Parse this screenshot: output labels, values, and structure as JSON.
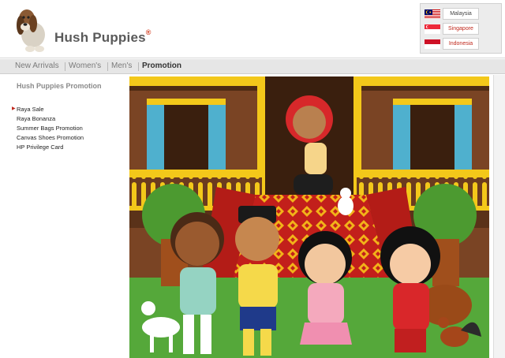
{
  "brand": {
    "name": "Hush Puppies",
    "registered_mark": "®",
    "logo_icon": "basset-hound-logo-icon"
  },
  "countries": [
    {
      "label": "Malaysia",
      "flag": "malaysia-flag-icon"
    },
    {
      "label": "Singapore",
      "flag": "singapore-flag-icon"
    },
    {
      "label": "Indonesia",
      "flag": "indonesia-flag-icon"
    }
  ],
  "nav": {
    "items": [
      {
        "label": "New Arrivals"
      },
      {
        "label": "Women's"
      },
      {
        "label": "Men's"
      },
      {
        "label": "Promotion",
        "active": true
      }
    ]
  },
  "sidebar": {
    "title": "Hush Puppies Promotion",
    "items": [
      {
        "label": "Raya Sale",
        "selected": true
      },
      {
        "label": "Raya Bonanza"
      },
      {
        "label": "Summer Bags Promotion"
      },
      {
        "label": "Canvas Shoes Promotion"
      },
      {
        "label": "HP Privilege Card"
      }
    ]
  },
  "main": {
    "banner": "raya-celebration-illustration"
  },
  "colors": {
    "accent_red": "#c0281c",
    "nav_bg": "#e6e6e6",
    "house_wood": "#6b3b1f",
    "railing_yellow": "#f3c81a",
    "carpet_red": "#c21f1b",
    "grass_green": "#55a83a"
  }
}
